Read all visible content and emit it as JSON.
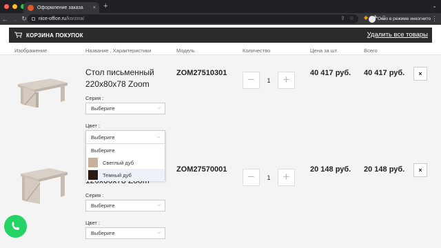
{
  "browser": {
    "tab_title": "Оформление заказа",
    "tab_close": "×",
    "new_tab": "+",
    "url_host": "nice-office.ru",
    "url_path": "/korzina/",
    "incognito_label": "Окно в режиме инкогнито",
    "traffic_colors": [
      "#ff5f57",
      "#febc2e",
      "#28c840"
    ]
  },
  "cart": {
    "title": "КОРЗИНА ПОКУПОК",
    "delete_all": "Удалить все товары"
  },
  "columns": [
    "Изображение",
    "Название , Характеристики",
    "Модель",
    "Количество",
    "Цена за шт.",
    "Всего"
  ],
  "items": [
    {
      "name_line1": "Стол письменный",
      "name_line2": "220х80х78 Zoom",
      "series_label": "Серия :",
      "series_value": "Выберите",
      "color_label": "Цвет :",
      "color_value": "Выберите",
      "model": "ZOM27510301",
      "qty": "1",
      "price": "40 417 руб.",
      "total": "40 417 руб."
    },
    {
      "name_line2": "120х60х78 Zoom",
      "series_label": "Серия :",
      "series_value": "Выберите",
      "color_label": "Цвет :",
      "color_value": "Выберите",
      "model": "ZOM27570001",
      "qty": "1",
      "price": "20 148 руб.",
      "total": "20 148 руб."
    }
  ],
  "qty_minus": "−",
  "qty_plus": "+",
  "remove_symbol": "×",
  "color_dropdown": {
    "current": "Выберите",
    "options": [
      {
        "label": "Выберите"
      },
      {
        "label": "Светлый дуб",
        "swatch": "#c9b09b"
      },
      {
        "label": "Темный дуб",
        "swatch": "#2a1a14"
      }
    ]
  },
  "icons": {
    "cart": "🛒",
    "chevron": "⌵"
  }
}
